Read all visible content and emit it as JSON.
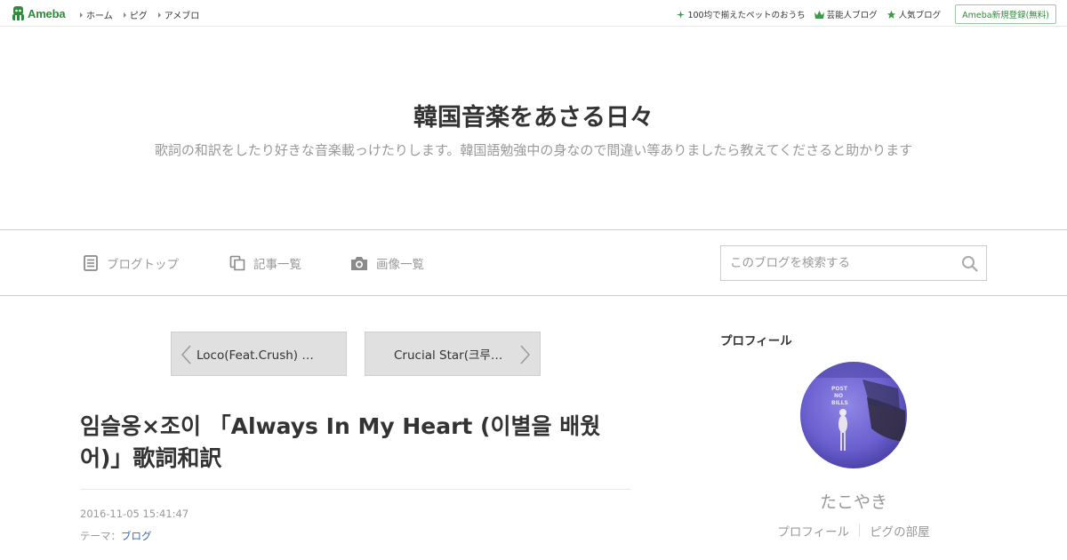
{
  "topbar": {
    "logo_text": "Ameba",
    "nav": [
      "ホーム",
      "ピグ",
      "アメブロ"
    ],
    "right_links": [
      {
        "label": "100均で揃えたペットのおうち",
        "icon": "sparkle-icon"
      },
      {
        "label": "芸能人ブログ",
        "icon": "crown-icon"
      },
      {
        "label": "人気ブログ",
        "icon": "star-icon"
      }
    ],
    "register_label": "Ameba新規登録(無料)"
  },
  "header": {
    "title": "韓国音楽をあさる日々",
    "description": "歌詞の和訳をしたり好きな音楽載っけたりします。韓国語勉強中の身なので間違い等ありましたら教えてくださると助かります"
  },
  "blog_nav": {
    "items": [
      {
        "label": "ブログトップ",
        "icon": "document-icon"
      },
      {
        "label": "記事一覧",
        "icon": "copy-icon"
      },
      {
        "label": "画像一覧",
        "icon": "camera-icon"
      }
    ],
    "search_placeholder": "このブログを検索する"
  },
  "pager": {
    "prev": "Loco(Feat.Crush) 「…",
    "next": "Crucial Star(크루셜…"
  },
  "article": {
    "title": "임슬옹×조이 「Always In My Heart (이별을 배웠어)」歌詞和訳",
    "date": "2016-11-05 15:41:47",
    "theme_label": "テーマ：",
    "theme_value": "ブログ"
  },
  "sidebar": {
    "heading": "プロフィール",
    "avatar_text": "POST NO BILLS",
    "nickname": "たこやき",
    "links": [
      "プロフィール",
      "ピグの部屋"
    ]
  },
  "colors": {
    "ameba_green": "#2d8c3c",
    "link_blue": "#3569a9",
    "muted_gray": "#999999"
  }
}
